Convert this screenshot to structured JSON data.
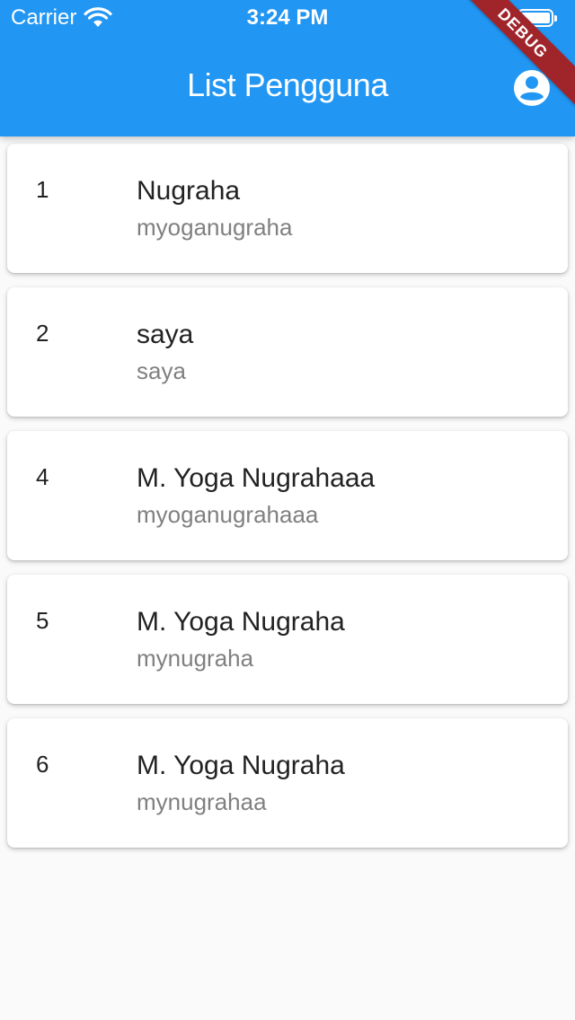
{
  "status_bar": {
    "carrier": "Carrier",
    "time": "3:24 PM"
  },
  "app_bar": {
    "title": "List Pengguna",
    "action_icon": "account-circle-icon",
    "color": "#2196f3"
  },
  "debug_banner": "DEBUG",
  "users": [
    {
      "id": "1",
      "name": "Nugraha",
      "username": "myoganugraha"
    },
    {
      "id": "2",
      "name": "saya",
      "username": "saya"
    },
    {
      "id": "4",
      "name": "M. Yoga Nugrahaaa",
      "username": "myoganugrahaaa"
    },
    {
      "id": "5",
      "name": "M. Yoga Nugraha",
      "username": "mynugraha"
    },
    {
      "id": "6",
      "name": "M. Yoga Nugraha",
      "username": "mynugrahaa"
    }
  ]
}
